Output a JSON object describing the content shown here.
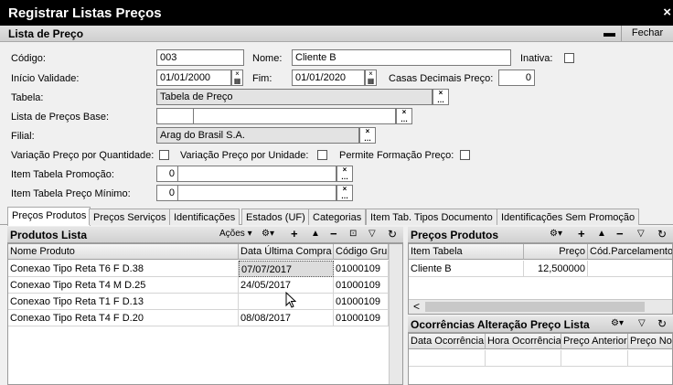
{
  "window": {
    "title": "Registrar Listas Preços",
    "close": "×"
  },
  "section": {
    "title": "Lista de Preço",
    "minimize": "▬",
    "close_label": "Fechar"
  },
  "form": {
    "codigo_label": "Código:",
    "codigo": "003",
    "nome_label": "Nome:",
    "nome": "Cliente B",
    "inativa_label": "Inativa:",
    "inicio_label": "Início Validade:",
    "inicio": "01/01/2000",
    "fim_label": "Fim:",
    "fim": "01/01/2020",
    "casas_label": "Casas Decimais Preço:",
    "casas": "0",
    "tabela_label": "Tabela:",
    "tabela": "Tabela de Preço",
    "lista_base_label": "Lista de Preços Base:",
    "lista_base_code": "",
    "lista_base_name": "",
    "filial_label": "Filial:",
    "filial": "Arag do Brasil S.A.",
    "var_qtd_label": "Variação Preço por Quantidade:",
    "var_unid_label": "Variação Preço por Unidade:",
    "permite_label": "Permite Formação Preço:",
    "item_promo_label": "Item Tabela Promoção:",
    "item_promo_code": "0",
    "item_promo_name": "",
    "item_min_label": "Item Tabela Preço Mínimo:",
    "item_min_code": "0",
    "item_min_name": ""
  },
  "tabs": [
    "Preços Produtos",
    "Preços Serviços",
    "Identificações",
    "Estados (UF)",
    "Categorias",
    "Item Tab. Tipos Documento",
    "Identificações Sem Promoção"
  ],
  "produtos_lista": {
    "title": "Produtos Lista",
    "acoes_label": "Ações",
    "columns": [
      "Nome Produto",
      "Data Última Compra",
      "Código Grup"
    ],
    "rows": [
      [
        "Conexao Tipo Reta T6 F D.38",
        "07/07/2017",
        "01000109"
      ],
      [
        "Conexao Tipo Reta T4 M D.25",
        "24/05/2017",
        "01000109"
      ],
      [
        "Conexao Tipo Reta T1 F D.13",
        "",
        "01000109"
      ],
      [
        "Conexao Tipo Reta T4 F D.20",
        "08/08/2017",
        "01000109"
      ]
    ]
  },
  "precos_produtos": {
    "title": "Preços Produtos",
    "columns": [
      "Item Tabela",
      "Preço",
      "Cód.Parcelamento"
    ],
    "rows": [
      [
        "Cliente B",
        "12,500000",
        ""
      ]
    ]
  },
  "ocorrencias": {
    "title": "Ocorrências Alteração Preço Lista",
    "columns": [
      "Data Ocorrência",
      "Hora Ocorrência",
      "Preço Anterior",
      "Preço No"
    ]
  },
  "icons": {
    "clear": "×\n…",
    "calendar": "×\n▦",
    "add": "+",
    "up": "▲",
    "remove": "−",
    "down": "▼",
    "export": "⊡",
    "filter": "▽",
    "refresh": "↻",
    "tools": "⚙▾",
    "scroll_left": "<",
    "scroll_right": ">"
  }
}
